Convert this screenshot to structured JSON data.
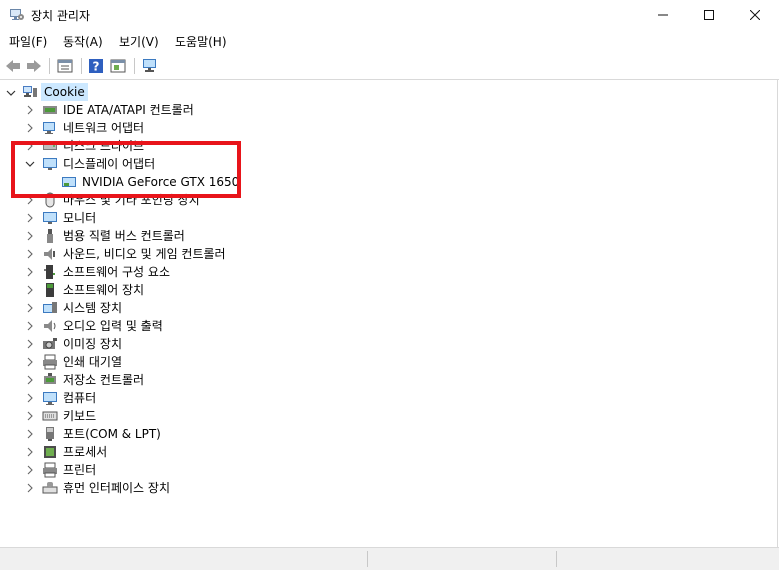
{
  "window": {
    "title": "장치 관리자",
    "minimize": "—",
    "maximize": "☐",
    "close": "✕"
  },
  "menu": [
    "파일(F)",
    "동작(A)",
    "보기(V)",
    "도움말(H)"
  ],
  "toolbar": {
    "buttons": [
      "back-arrow-icon",
      "forward-arrow-icon",
      "properties-icon",
      "help-icon",
      "show-hidden-icon",
      "scan-hardware-icon"
    ]
  },
  "tree": {
    "root": "Cookie",
    "categories": [
      {
        "label": "IDE ATA/ATAPI 컨트롤러",
        "icon": "ide-controller-icon",
        "expanded": false
      },
      {
        "label": "네트워크 어댑터",
        "icon": "network-adapter-icon",
        "expanded": false
      },
      {
        "label": "디스크 드라이브",
        "icon": "disk-drive-icon",
        "expanded": false
      },
      {
        "label": "디스플레이 어댑터",
        "icon": "display-adapter-icon",
        "expanded": true,
        "children": [
          {
            "label": "NVIDIA GeForce GTX 1650",
            "icon": "gpu-icon"
          }
        ]
      },
      {
        "label": "마우스 및 기타 포인팅 장치",
        "icon": "mouse-icon",
        "expanded": false
      },
      {
        "label": "모니터",
        "icon": "monitor-icon",
        "expanded": false
      },
      {
        "label": "범용 직렬 버스 컨트롤러",
        "icon": "usb-icon",
        "expanded": false
      },
      {
        "label": "사운드, 비디오 및 게임 컨트롤러",
        "icon": "speaker-icon",
        "expanded": false
      },
      {
        "label": "소프트웨어 구성 요소",
        "icon": "software-component-icon",
        "expanded": false
      },
      {
        "label": "소프트웨어 장치",
        "icon": "software-device-icon",
        "expanded": false
      },
      {
        "label": "시스템 장치",
        "icon": "system-device-icon",
        "expanded": false
      },
      {
        "label": "오디오 입력 및 출력",
        "icon": "audio-io-icon",
        "expanded": false
      },
      {
        "label": "이미징 장치",
        "icon": "camera-icon",
        "expanded": false
      },
      {
        "label": "인쇄 대기열",
        "icon": "print-queue-icon",
        "expanded": false
      },
      {
        "label": "저장소 컨트롤러",
        "icon": "storage-controller-icon",
        "expanded": false
      },
      {
        "label": "컴퓨터",
        "icon": "computer-icon",
        "expanded": false
      },
      {
        "label": "키보드",
        "icon": "keyboard-icon",
        "expanded": false
      },
      {
        "label": "포트(COM & LPT)",
        "icon": "port-icon",
        "expanded": false
      },
      {
        "label": "프로세서",
        "icon": "processor-icon",
        "expanded": false
      },
      {
        "label": "프린터",
        "icon": "printer-icon",
        "expanded": false
      },
      {
        "label": "휴먼 인터페이스 장치",
        "icon": "hid-icon",
        "expanded": false
      }
    ]
  },
  "annotation": {
    "highlight_color": "#e8141a"
  }
}
